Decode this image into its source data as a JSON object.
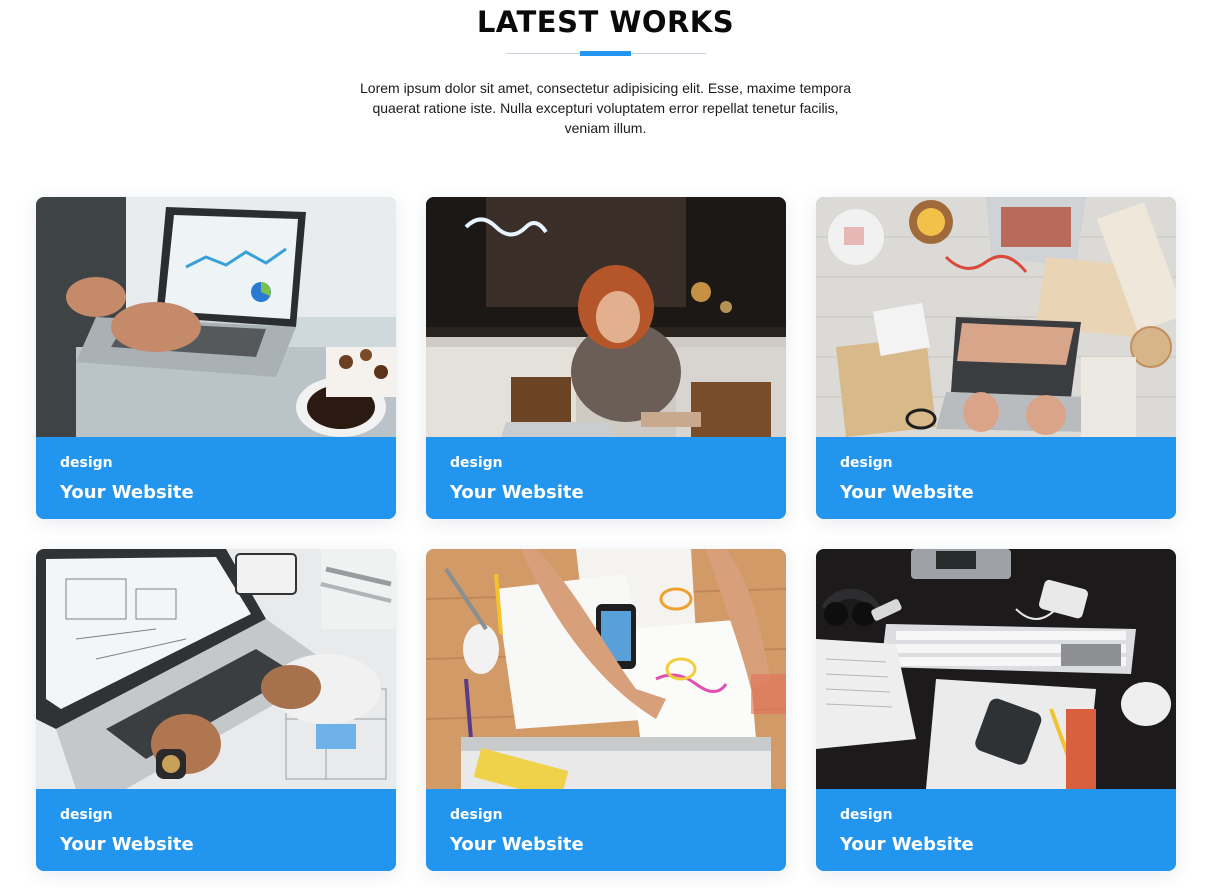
{
  "section": {
    "title": "LATEST WORKS",
    "intro": "Lorem ipsum dolor sit amet, consectetur adipisicing elit. Esse, maxime tempora quaerat ratione iste. Nulla excepturi voluptatem error repellat tenetur facilis, veniam illum.",
    "accent_color": "#2295ef"
  },
  "works": [
    {
      "category": "design",
      "title": "Your Website",
      "image": "laptop-analytics-coffee-photo"
    },
    {
      "category": "design",
      "title": "Your Website",
      "image": "woman-laptop-cafe-photo"
    },
    {
      "category": "design",
      "title": "Your Website",
      "image": "desk-laptop-crafts-flatlay-photo"
    },
    {
      "category": "design",
      "title": "Your Website",
      "image": "laptop-blueprints-photo"
    },
    {
      "category": "design",
      "title": "Your Website",
      "image": "desk-sketching-phone-photo"
    },
    {
      "category": "design",
      "title": "Your Website",
      "image": "dark-desk-keyboard-photo"
    }
  ]
}
